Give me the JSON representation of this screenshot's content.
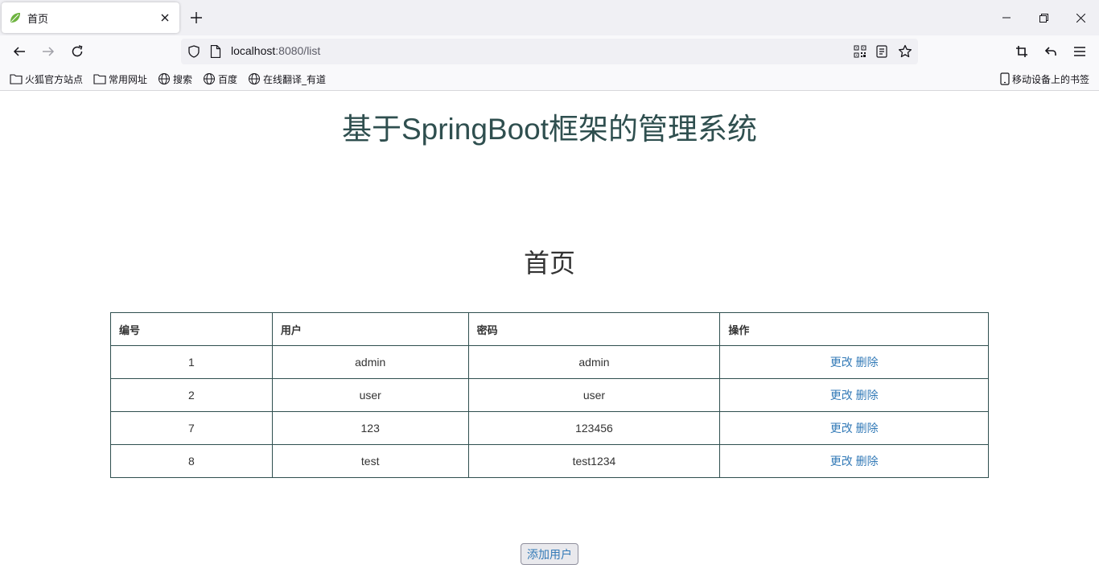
{
  "browser": {
    "tab_title": "首页",
    "url_host": "localhost",
    "url_rest": ":8080/list",
    "bookmarks": [
      "火狐官方站点",
      "常用网址",
      "搜索",
      "百度",
      "在线翻译_有道"
    ],
    "mobile_bookmarks": "移动设备上的书签"
  },
  "page": {
    "header": "基于SpringBoot框架的管理系统",
    "title": "首页",
    "table": {
      "columns": [
        "编号",
        "用户",
        "密码",
        "操作"
      ],
      "rows": [
        {
          "id": "1",
          "user": "admin",
          "password": "admin"
        },
        {
          "id": "2",
          "user": "user",
          "password": "user"
        },
        {
          "id": "7",
          "user": "123",
          "password": "123456"
        },
        {
          "id": "8",
          "user": "test",
          "password": "test1234"
        }
      ],
      "edit_label": "更改",
      "delete_label": "删除"
    },
    "add_button": "添加用户"
  },
  "colors": {
    "header": "#2f4f4f",
    "link": "#337ab7",
    "border": "#2f4f4f"
  }
}
